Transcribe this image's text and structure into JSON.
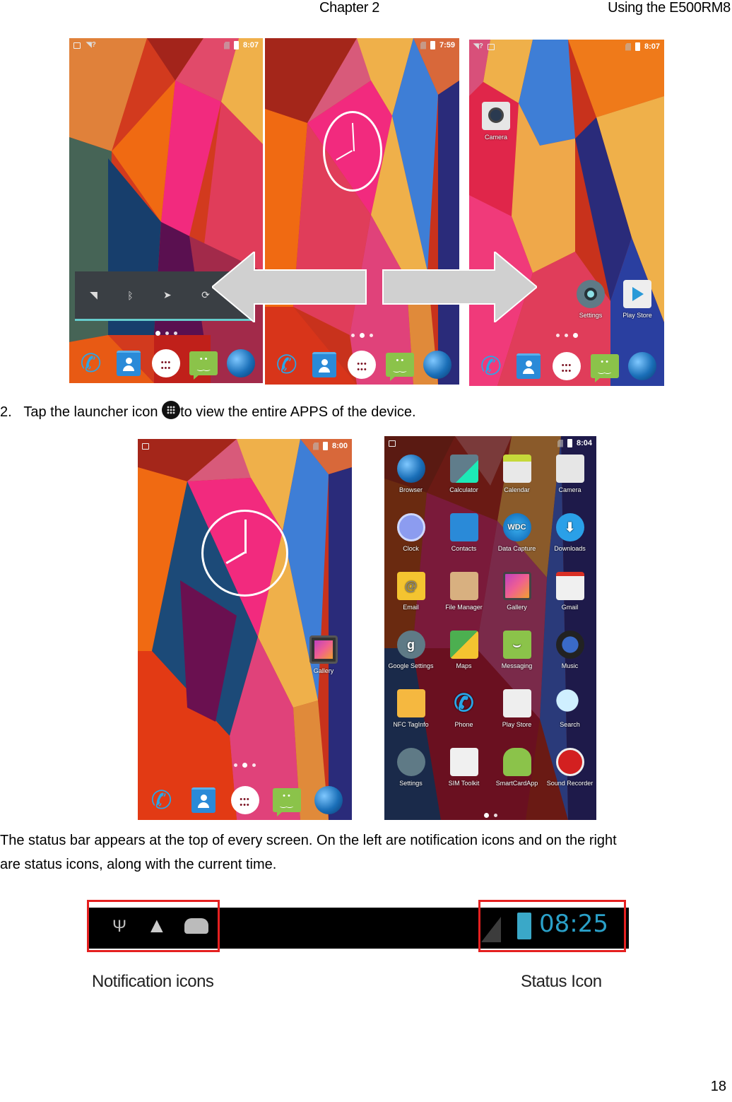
{
  "header": {
    "chapter": "Chapter 2",
    "section": "Using the E500RM8"
  },
  "screens_top": [
    {
      "status_time": "8:07",
      "notification_icons": [
        "image-icon",
        "wifi-question-icon"
      ],
      "quick_settings": [
        "wifi-icon",
        "bluetooth-icon",
        "location-icon",
        "sync-icon"
      ],
      "page_dots": 3,
      "active_dot": 0
    },
    {
      "status_time": "7:59",
      "notification_icons": [],
      "widget": "analog-clock",
      "page_dots": 3,
      "active_dot": 1
    },
    {
      "status_time": "8:07",
      "notification_icons": [
        "wifi-question-icon",
        "image-icon"
      ],
      "apps": [
        {
          "label": "Camera"
        },
        {
          "label": "Settings"
        },
        {
          "label": "Play Store"
        }
      ],
      "page_dots": 3,
      "active_dot": 2
    }
  ],
  "dock": [
    "Phone",
    "Contacts",
    "Launcher",
    "Messaging",
    "Browser"
  ],
  "arrows": [
    "swipe-left-arrow",
    "swipe-right-arrow"
  ],
  "step2": {
    "number": "2.",
    "text_before": "Tap the launcher icon",
    "text_after": "to view the entire APPS of the device."
  },
  "screens_bottom": {
    "home": {
      "status_time": "8:00",
      "apps": [
        {
          "label": "Gallery"
        }
      ],
      "page_dots": 3,
      "active_dot": 1
    },
    "app_drawer": {
      "status_time": "8:04",
      "apps": [
        {
          "label": "Browser"
        },
        {
          "label": "Calculator"
        },
        {
          "label": "Calendar"
        },
        {
          "label": "Camera"
        },
        {
          "label": "Clock"
        },
        {
          "label": "Contacts"
        },
        {
          "label": "Data Capture"
        },
        {
          "label": "Downloads"
        },
        {
          "label": "Email"
        },
        {
          "label": "File Manager"
        },
        {
          "label": "Gallery"
        },
        {
          "label": "Gmail"
        },
        {
          "label": "Google Settings"
        },
        {
          "label": "Maps"
        },
        {
          "label": "Messaging"
        },
        {
          "label": "Music"
        },
        {
          "label": "NFC TagInfo"
        },
        {
          "label": "Phone"
        },
        {
          "label": "Play Store"
        },
        {
          "label": "Search"
        },
        {
          "label": "Settings"
        },
        {
          "label": "SIM Toolkit"
        },
        {
          "label": "SmartCardApp"
        },
        {
          "label": "Sound Recorder"
        }
      ],
      "page_dots": 2,
      "active_dot": 0
    }
  },
  "paragraph": {
    "line1": "The status bar appears at the top of every screen. On the left are notification icons and on the right",
    "line2": "are status icons, along with the current time."
  },
  "statusbar_demo": {
    "notification_icons": [
      "usb-icon",
      "warning-icon",
      "android-debug-icon"
    ],
    "status_icons": [
      "signal-icon",
      "battery-charging-icon"
    ],
    "time": "08:25",
    "label_left": "Notification icons",
    "label_right": "Status Icon",
    "highlight_color": "#e52020",
    "time_color": "#2aa0c8"
  },
  "page_number": "18"
}
